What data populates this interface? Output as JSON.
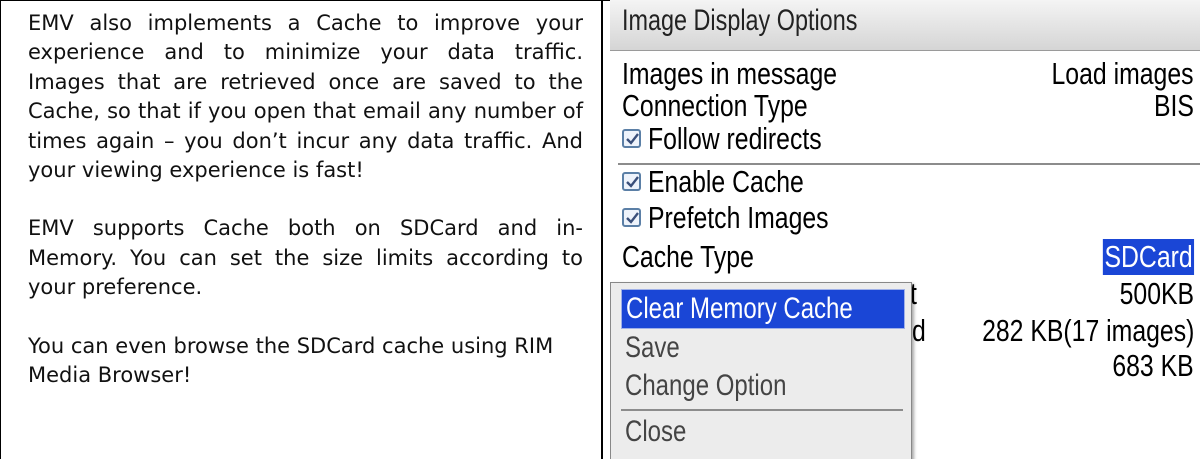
{
  "document": {
    "paragraphs": [
      "EMV also implements a Cache to improve your experience and to minimize your data traffic. Images that are retrieved once are saved to the Cache, so that if you open that email any number of times again – you don’t incur any data traffic. And your viewing experience is fast!",
      "EMV supports Cache both on SDCard and in-Memory. You can set the size limits according to your preference.",
      "You can even browse the SDCard cache using RIM Media Browser!"
    ]
  },
  "screen": {
    "header_title": "Image Display Options",
    "rows": {
      "images_in_message": {
        "label": "Images in message",
        "value": "Load images"
      },
      "connection_type": {
        "label": "Connection Type",
        "value": "BIS"
      },
      "follow_redirects": {
        "label": "Follow redirects",
        "checked": true
      },
      "enable_cache": {
        "label": "Enable Cache",
        "checked": true
      },
      "prefetch_images": {
        "label": "Prefetch Images",
        "checked": true
      },
      "cache_type": {
        "label": "Cache Type",
        "value": "SDCard"
      },
      "memory_limit": {
        "label_tail": "t",
        "value": "500KB"
      },
      "cache_used": {
        "label_tail": "d",
        "value": "282 KB(17 images)"
      },
      "cache_other": {
        "value": "683 KB"
      }
    },
    "menu": {
      "items": [
        "Clear Memory Cache",
        "Save",
        "Change Option",
        "Close"
      ],
      "active_index": 0
    },
    "colors": {
      "selection": "#1a46d6",
      "checkbox_border": "#5b7fa6"
    }
  }
}
